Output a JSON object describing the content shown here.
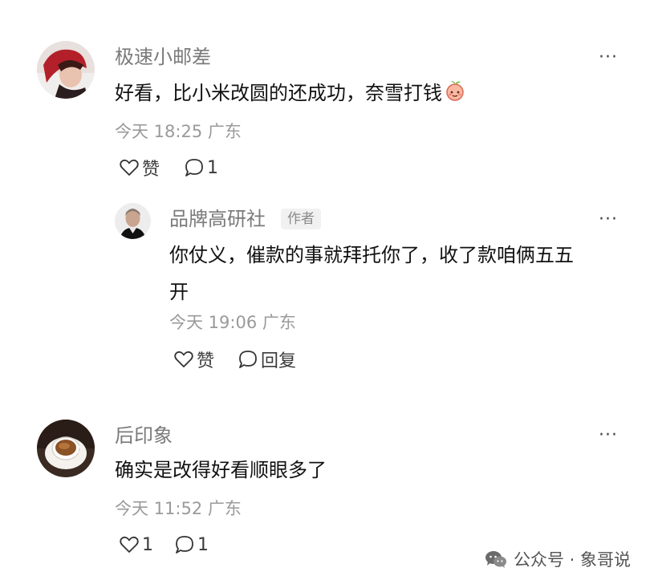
{
  "comments": [
    {
      "username": "极速小邮差",
      "text": "好看，比小米改圆的还成功，奈雪打钱",
      "emoji_icon": "peach-emoji-icon",
      "timestamp": "今天 18:25",
      "location": "广东",
      "like_label": "赞",
      "reply_count": "1",
      "reply": {
        "username": "品牌高研社",
        "badge": "作者",
        "text_line1": "你仗义，催款的事就拜托你了，收了款咱俩五五",
        "text_line2": "开",
        "timestamp": "今天 19:06",
        "location": "广东",
        "like_label": "赞",
        "reply_label": "回复"
      }
    },
    {
      "username": "后印象",
      "text": "确实是改得好看顺眼多了",
      "timestamp": "今天 11:52",
      "location": "广东",
      "like_count": "1",
      "reply_count": "1"
    }
  ],
  "more_label": "···",
  "watermark": "公众号 · 象哥说",
  "colors": {
    "text": "#111111",
    "muted": "#9a9a9a",
    "name": "#7a7a7a"
  }
}
